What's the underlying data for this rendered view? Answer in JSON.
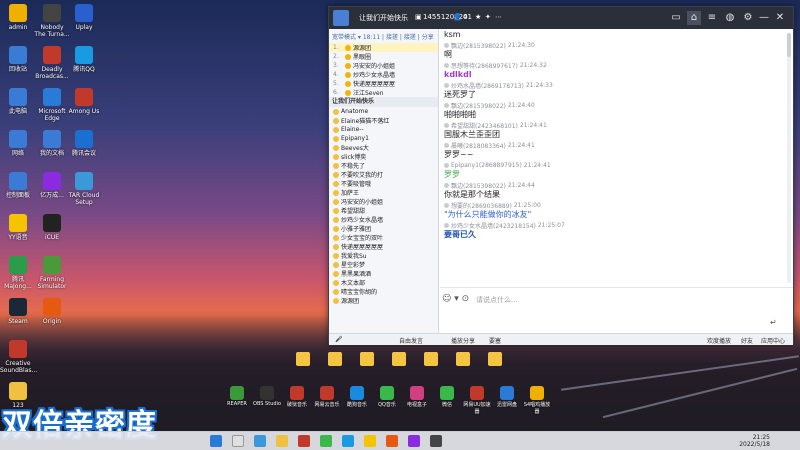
{
  "desktop": {
    "icons": [
      {
        "label": "admin",
        "color": "#f0b000"
      },
      {
        "label": "回收站",
        "color": "#3a7bd5"
      },
      {
        "label": "此电脑",
        "color": "#3a7bd5"
      },
      {
        "label": "网络",
        "color": "#3a7bd5"
      },
      {
        "label": "控制面板",
        "color": "#3a7bd5"
      },
      {
        "label": "YY语音",
        "color": "#f5c400"
      },
      {
        "label": "腾讯MaJong...",
        "color": "#2a9d4a"
      },
      {
        "label": "Steam",
        "color": "#1b2838"
      },
      {
        "label": "Creative SoundBlas...",
        "color": "#c0392b"
      },
      {
        "label": "123",
        "color": "#f0c040"
      },
      {
        "label": "Nobody The Turna...",
        "color": "#444"
      },
      {
        "label": "Deadly Broadcas...",
        "color": "#c0392b"
      },
      {
        "label": "Microsoft Edge",
        "color": "#2a7ad8"
      },
      {
        "label": "我的文档",
        "color": "#3a7bd5"
      },
      {
        "label": "亿万成...",
        "color": "#8a2be2"
      },
      {
        "label": "iCUE",
        "color": "#222"
      },
      {
        "label": "Farming Simulator",
        "color": "#4a9a3a"
      },
      {
        "label": "Origin",
        "color": "#e55a10"
      },
      {
        "label": "Uplay",
        "color": "#2a5fd0"
      },
      {
        "label": "腾讯QQ",
        "color": "#1a9ae0"
      },
      {
        "label": "Among Us",
        "color": "#c0392b"
      },
      {
        "label": "腾讯会议",
        "color": "#1a6fd0"
      },
      {
        "label": "TAR Cloud Setup",
        "color": "#3a9ad9"
      }
    ]
  },
  "chat_window": {
    "title": "让我们开始快乐",
    "group_id": "1455120820",
    "member_count": "41",
    "left_pane": {
      "header_mode": "宽带模式",
      "header_time": "18:11",
      "header_links": [
        "接搓",
        "接搓",
        "分享"
      ],
      "top_items": [
        {
          "num": "1.",
          "name": "源源团",
          "sel": true
        },
        {
          "num": "2.",
          "name": "黑眼圈",
          "sel": false
        },
        {
          "num": "3.",
          "name": "冯安安的小姐姐",
          "sel": false
        },
        {
          "num": "4.",
          "name": "炒鸡少女水晶墙",
          "sel": false
        },
        {
          "num": "5.",
          "name": "快递屋屋屋屋屋",
          "sel": false
        },
        {
          "num": "6.",
          "name": "汪江Seven",
          "sel": false
        }
      ],
      "group_label": "让我们开始快乐",
      "members": [
        "Anatome",
        "Elaine猫猫不落红",
        "Elaine--",
        "Epipany1",
        "Beeves大",
        "slick博奕",
        "不稳先了",
        "不要吹艾我的打",
        "不要吸管哦",
        "加萨王",
        "冯安安的小姐姐",
        "希望甜甜",
        "炒鸡少女水晶墙",
        "小雅子雅团",
        "少女宝宝的双叶",
        "快递屋屋屋屋屋",
        "我爱我Su",
        "星空彩梦",
        "黑黑果酒酒",
        "木文本部",
        "晴宝宝你胡的",
        "源源团"
      ]
    },
    "messages": [
      {
        "sender": "",
        "time": "",
        "text": "ksm"
      },
      {
        "sender": "飘边(2815398022)",
        "time": "21:24:30",
        "text": "啊",
        "color": "#222"
      },
      {
        "sender": "思想等待(2868997617)",
        "time": "21:24:32",
        "text": "kdlkdl",
        "color": "#a03ad0"
      },
      {
        "sender": "炒鸡水晶墙(2869178713)",
        "time": "21:24:33",
        "text": "迷死罗了",
        "color": "#222"
      },
      {
        "sender": "飘边(2815398022)",
        "time": "21:24:40",
        "text": "啪啪啪啪",
        "color": "#222"
      },
      {
        "sender": "希望甜甜(2423468101)",
        "time": "21:24:41",
        "text": "国服木兰歪歪团",
        "color": "#222"
      },
      {
        "sender": "晨曦(2818083364)",
        "time": "21:24:41",
        "text": "罗罗~~",
        "color": "#222"
      },
      {
        "sender": "Epipany1(2868897915)",
        "time": "21:24:41",
        "text": "罗罗",
        "color": "#3aa84a"
      },
      {
        "sender": "飘边(2815398022)",
        "time": "21:24:44",
        "text": "你就是那个结果",
        "color": "#222"
      },
      {
        "sender": "想要的(2869036889)",
        "time": "21:25:00",
        "text": "\"为什么只能做你的冰友\"",
        "color": "#2a5fd0"
      },
      {
        "sender": "炒鸡少女水晶墙(2423218154)",
        "time": "21:25:07",
        "text": "要哥已久",
        "color": "#1a4fb0"
      }
    ],
    "input_placeholder": "请说点什么...",
    "bottom_bar": {
      "items": [
        "自由发言",
        "播放分享",
        "要塞"
      ],
      "right_items": [
        "欢度播放",
        "好友",
        "应用中心"
      ]
    }
  },
  "taskbar": {
    "time": "21:25",
    "date": "2022/5/18"
  },
  "dock": [
    {
      "label": "REAPER",
      "color": "#3a9a3a"
    },
    {
      "label": "OBS Studio",
      "color": "#333"
    },
    {
      "label": "破狱音乐",
      "color": "#c0392b"
    },
    {
      "label": "网易云音乐",
      "color": "#c0392b"
    },
    {
      "label": "酷狗音乐",
      "color": "#1a8ae0"
    },
    {
      "label": "QQ音乐",
      "color": "#3ab84a"
    },
    {
      "label": "电视盒子",
      "color": "#d04080"
    },
    {
      "label": "微信",
      "color": "#3ab84a"
    },
    {
      "label": "网易UU加速器",
      "color": "#c0392b"
    },
    {
      "label": "迅雷网盘",
      "color": "#2a7ad8"
    },
    {
      "label": "S4唱鸡播放器",
      "color": "#f0b000"
    }
  ],
  "caption": "双倍亲密度"
}
